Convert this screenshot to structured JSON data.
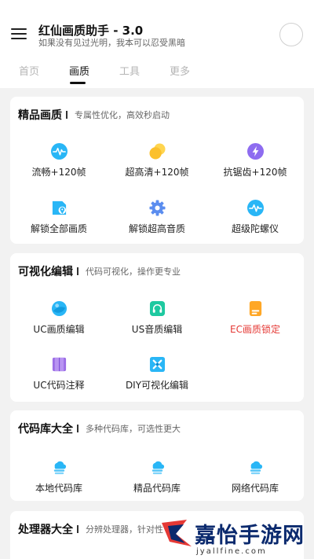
{
  "header": {
    "title": "红仙画质助手 - 3.0",
    "subtitle": "如果没有见过光明，我本可以忍受黑暗"
  },
  "tabs": [
    {
      "label": "首页",
      "active": false
    },
    {
      "label": "画质",
      "active": true
    },
    {
      "label": "工具",
      "active": false
    },
    {
      "label": "更多",
      "active": false
    }
  ],
  "sections": [
    {
      "title": "精品画质",
      "desc": "专属性优化，高效秒启动",
      "items": [
        {
          "label": "流畅+120帧",
          "icon": "pulse-icon"
        },
        {
          "label": "超高清+120帧",
          "icon": "circles-icon"
        },
        {
          "label": "抗锯齿+120帧",
          "icon": "lightning-icon"
        },
        {
          "label": "解锁全部画质",
          "icon": "file-location-icon"
        },
        {
          "label": "解锁超高音质",
          "icon": "gear-icon"
        },
        {
          "label": "超级陀螺仪",
          "icon": "pulse-icon"
        }
      ]
    },
    {
      "title": "可视化编辑",
      "desc": "代码可视化，操作更专业",
      "items": [
        {
          "label": "UC画质编辑",
          "icon": "sphere-icon"
        },
        {
          "label": "US音质编辑",
          "icon": "headset-icon"
        },
        {
          "label": "EC画质锁定",
          "icon": "document-icon",
          "highlight": "#e53935"
        },
        {
          "label": "UC代码注释",
          "icon": "book-icon"
        },
        {
          "label": "DIY可视化编辑",
          "icon": "cross-icon"
        }
      ]
    },
    {
      "title": "代码库大全",
      "desc": "多种代码库，可选性更大",
      "items": [
        {
          "label": "本地代码库",
          "icon": "cloud-stack-icon"
        },
        {
          "label": "精品代码库",
          "icon": "cloud-stack-icon"
        },
        {
          "label": "网络代码库",
          "icon": "cloud-stack-icon"
        }
      ]
    },
    {
      "title": "处理器大全",
      "desc": "分辨处理器，针对性"
    }
  ],
  "watermark": {
    "title": "嘉怡手游网",
    "url": "jyallfine.com"
  },
  "colors": {
    "cyan": "#29b6f6",
    "yellow": "#fbc02d",
    "purple": "#8e6cf0",
    "teal": "#1ec9a0",
    "orange": "#ffa726",
    "violet": "#9c6ee6",
    "red": "#e53935",
    "navy": "#0b2a6e"
  }
}
